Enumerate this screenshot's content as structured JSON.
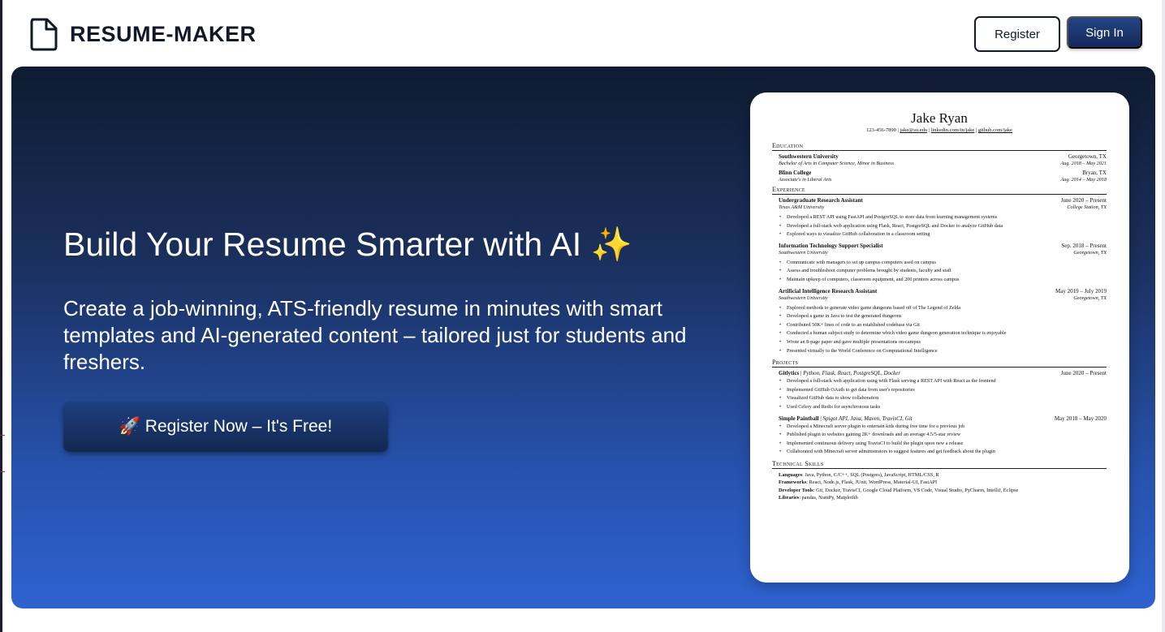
{
  "brand": {
    "name": "RESUME-MAKER",
    "icon": "document-icon"
  },
  "nav": {
    "register_label": "Register",
    "signin_label": "Sign In"
  },
  "hero": {
    "title": "Build Your Resume Smarter with AI ✨",
    "subtitle": "Create a job-winning, ATS-friendly resume in minutes with smart templates and AI-generated content – tailored just for students and freshers.",
    "cta_label": "🚀 Register Now – It's Free!"
  },
  "colors": {
    "hero_top": "#0f1b31",
    "hero_bottom": "#2e62d0",
    "button_primary": "#1d3f82"
  },
  "resume": {
    "name": "Jake Ryan",
    "contact": {
      "phone": "123-456-7890",
      "email": "jake@su.edu",
      "linkedin": "linkedin.com/in/jake",
      "github": "github.com/jake"
    },
    "education_heading": "Education",
    "education": [
      {
        "school": "Southwestern University",
        "location": "Georgetown, TX",
        "degree": "Bachelor of Arts in Computer Science, Minor in Business",
        "dates": "Aug. 2018 – May 2021"
      },
      {
        "school": "Blinn College",
        "location": "Bryan, TX",
        "degree": "Associate's in Liberal Arts",
        "dates": "Aug. 2014 – May 2018"
      }
    ],
    "experience_heading": "Experience",
    "experience": [
      {
        "title": "Undergraduate Research Assistant",
        "dates": "June 2020 – Present",
        "org": "Texas A&M University",
        "location": "College Station, TX",
        "bullets": [
          "Developed a REST API using FastAPI and PostgreSQL to store data from learning management systems",
          "Developed a full-stack web application using Flask, React, PostgreSQL and Docker to analyze GitHub data",
          "Explored ways to visualize GitHub collaboration in a classroom setting"
        ]
      },
      {
        "title": "Information Technology Support Specialist",
        "dates": "Sep. 2018 – Present",
        "org": "Southwestern University",
        "location": "Georgetown, TX",
        "bullets": [
          "Communicate with managers to set up campus computers used on campus",
          "Assess and troubleshoot computer problems brought by students, faculty and staff",
          "Maintain upkeep of computers, classroom equipment, and 200 printers across campus"
        ]
      },
      {
        "title": "Artificial Intelligence Research Assistant",
        "dates": "May 2019 – July 2019",
        "org": "Southwestern University",
        "location": "Georgetown, TX",
        "bullets": [
          "Explored methods to generate video game dungeons based off of The Legend of Zelda",
          "Developed a game in Java to test the generated dungeons",
          "Contributed 50K+ lines of code to an established codebase via Git",
          "Conducted a human subject study to determine which video game dungeon generation technique is enjoyable",
          "Wrote an 8-page paper and gave multiple presentations on-campus",
          "Presented virtually to the World Conference on Computational Intelligence"
        ]
      }
    ],
    "projects_heading": "Projects",
    "projects": [
      {
        "name": "Gitlytics",
        "stack": "Python, Flask, React, PostgreSQL, Docker",
        "dates": "June 2020 – Present",
        "bullets": [
          "Developed a full-stack web application using with Flask serving a REST API with React as the frontend",
          "Implemented GitHub OAuth to get data from user's repositories",
          "Visualized GitHub data to show collaboration",
          "Used Celery and Redis for asynchronous tasks"
        ]
      },
      {
        "name": "Simple Paintball",
        "stack": "Spigot API, Java, Maven, TravisCI, Git",
        "dates": "May 2018 – May 2020",
        "bullets": [
          "Developed a Minecraft server plugin to entertain kids during free time for a previous job",
          "Published plugin to websites gaining 2K+ downloads and an average 4.5/5-star review",
          "Implemented continuous delivery using TravisCI to build the plugin upon new a release",
          "Collaborated with Minecraft server administrators to suggest features and get feedback about the plugin"
        ]
      }
    ],
    "skills_heading": "Technical Skills",
    "skills": [
      {
        "label": "Languages",
        "value": "Java, Python, C/C++, SQL (Postgres), JavaScript, HTML/CSS, R"
      },
      {
        "label": "Frameworks",
        "value": "React, Node.js, Flask, JUnit, WordPress, Material-UI, FastAPI"
      },
      {
        "label": "Developer Tools",
        "value": "Git, Docker, TravisCI, Google Cloud Platform, VS Code, Visual Studio, PyCharm, IntelliJ, Eclipse"
      },
      {
        "label": "Libraries",
        "value": "pandas, NumPy, Matplotlib"
      }
    ]
  }
}
